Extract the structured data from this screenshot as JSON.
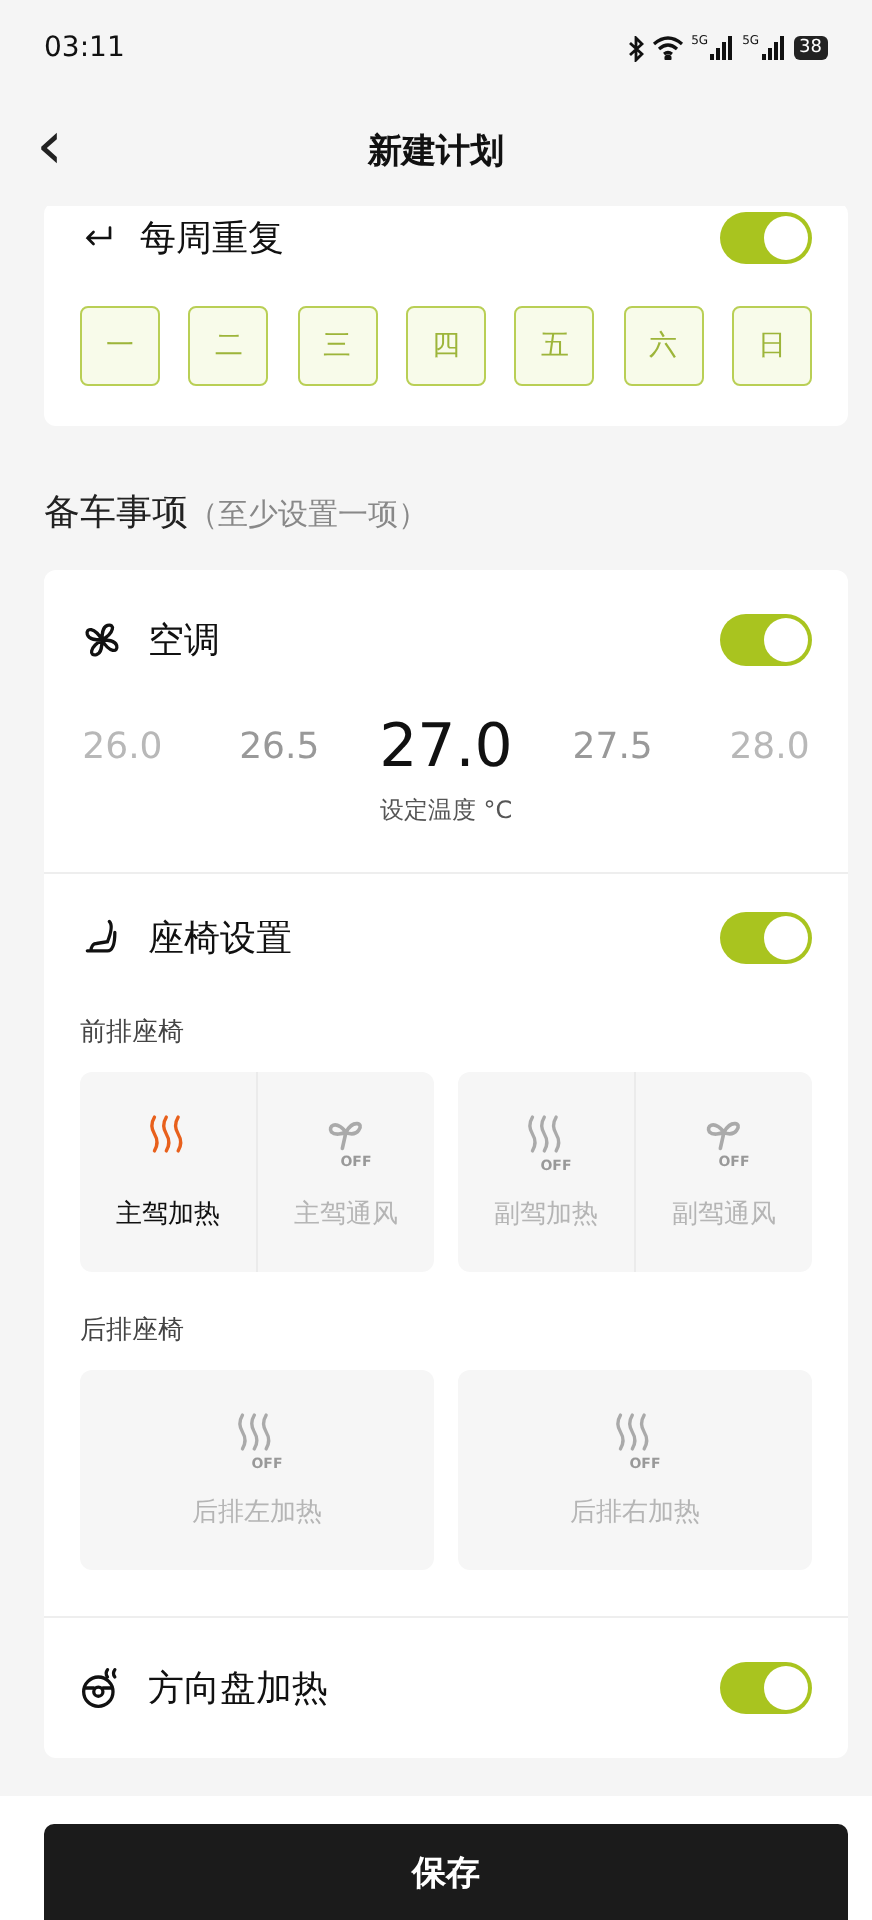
{
  "status_bar": {
    "time": "03:11",
    "signals": [
      "5G",
      "5G"
    ],
    "battery": "38"
  },
  "header": {
    "back": "‹",
    "title": "新建计划"
  },
  "repeat": {
    "label": "每周重复",
    "on": true,
    "days": [
      {
        "label": "一",
        "selected": false
      },
      {
        "label": "二",
        "selected": false
      },
      {
        "label": "三",
        "selected": false
      },
      {
        "label": "四",
        "selected": false
      },
      {
        "label": "五",
        "selected": false
      },
      {
        "label": "六",
        "selected": false
      },
      {
        "label": "日",
        "selected": false
      }
    ]
  },
  "section": {
    "title": "备车事项",
    "hint": "（至少设置一项）"
  },
  "climate": {
    "label": "空调",
    "on": true,
    "temps": [
      {
        "value": "26.0",
        "selected": false
      },
      {
        "value": "26.5",
        "selected": false
      },
      {
        "value": "27.0",
        "selected": true
      },
      {
        "value": "27.5",
        "selected": false
      },
      {
        "value": "28.0",
        "selected": false
      }
    ],
    "caption": "设定温度 °C"
  },
  "seats": {
    "label": "座椅设置",
    "on": true,
    "groups": [
      {
        "title": "前排座椅",
        "pairs": [
          [
            {
              "label": "主驾加热",
              "kind": "heat",
              "on": true
            },
            {
              "label": "主驾通风",
              "kind": "vent",
              "on": false,
              "badge": "OFF"
            }
          ],
          [
            {
              "label": "副驾加热",
              "kind": "heat",
              "on": false,
              "badge": "OFF"
            },
            {
              "label": "副驾通风",
              "kind": "vent",
              "on": false,
              "badge": "OFF"
            }
          ]
        ]
      },
      {
        "title": "后排座椅",
        "pairs": [
          [
            {
              "label": "后排左加热",
              "kind": "heat",
              "on": false,
              "badge": "OFF"
            }
          ],
          [
            {
              "label": "后排右加热",
              "kind": "heat",
              "on": false,
              "badge": "OFF"
            }
          ]
        ]
      }
    ]
  },
  "wheel": {
    "label": "方向盘加热",
    "on": true
  },
  "save": "保存"
}
